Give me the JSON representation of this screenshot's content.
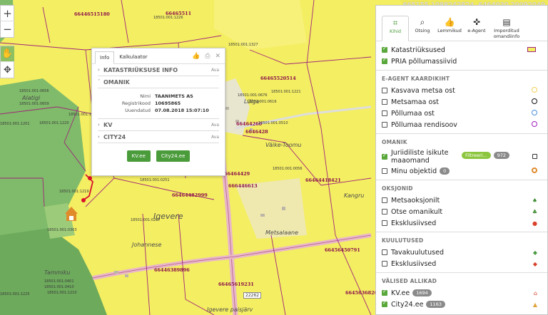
{
  "coords": "665155.1088242824, 6464030.20092049",
  "colors": {
    "accent": "#4a9b3a",
    "map_yellow": "#f4ee62",
    "forest_green": "#7fbb6a",
    "parcel_border": "#a0267a",
    "road": "#e8b8c8"
  },
  "map": {
    "big_labels": [
      "66446515180",
      "66465511",
      "66465520514",
      "66464260",
      "6646428",
      "666446613",
      "66464418421",
      "66464482999",
      "66464429",
      "66446389896",
      "66465619231",
      "66456450791",
      "66456368201"
    ],
    "parcel_ids": [
      "18501:001:1226",
      "18501:001:0656",
      "18501:001:0659",
      "18501:001:1201",
      "18501:001:1220",
      "18501:001:1243",
      "18501:001:1327",
      "18501:001:0676",
      "18501:001:0616",
      "18501:001:0510",
      "18501:001:0056",
      "18501:001:0257",
      "18501:001:0303",
      "18501:001:0251",
      "18501:001:0410",
      "18501:001:1225",
      "18501:001:1210",
      "18501:001:1221",
      "18501:001:0401",
      "18501:001:1219"
    ],
    "place_names": {
      "alatigi": "Alatigi",
      "luige": "Lüige",
      "vaike_toomu": "Väike-Toomu",
      "igevere": "Igevere",
      "johannese": "Johannese",
      "tammiku": "Tammiku",
      "kangru": "Kangru",
      "metsalaane": "Metsalaane",
      "igevere_paisjarv": "Igevere paisjärv"
    },
    "road_number": "22262"
  },
  "map_controls": {
    "zoom_in": "+",
    "zoom_out": "−"
  },
  "popup": {
    "tabs": [
      "Info",
      "Kalkulaator"
    ],
    "sections": {
      "katastri": "KATASTRIÜKSUSE INFO",
      "omanik": "OMANIK",
      "kv": "KV",
      "city24": "CITY24"
    },
    "open_label": "Ava",
    "owner": {
      "name_label": "Nimi",
      "name_value": "TAANIMETS AS",
      "reg_label": "Registrikood",
      "reg_value": "10695865",
      "updated_label": "Uuendatud",
      "updated_value": "07.08.2018 15:07:10"
    },
    "buttons": {
      "kv": "KV.ee",
      "city24": "City24.ee"
    }
  },
  "panel": {
    "tabs": [
      {
        "label": "Kihid",
        "icon": "layers-icon"
      },
      {
        "label": "Otsing",
        "icon": "search-icon"
      },
      {
        "label": "Lemmikud",
        "icon": "thumbs-up-icon"
      },
      {
        "label": "e-Agent",
        "icon": "crosshair-icon"
      },
      {
        "label": "Imporditud omandiinfo",
        "icon": "document-icon"
      }
    ],
    "base_layers": [
      {
        "label": "Katastriüksused",
        "checked": true
      },
      {
        "label": "PRIA põllumassiivid",
        "checked": true
      }
    ],
    "eagent": {
      "title": "E-AGENT KAARDIKIHT",
      "items": [
        {
          "label": "Kasvava metsa ost",
          "color": "#f1d35a"
        },
        {
          "label": "Metsamaa ost",
          "color": "#111111"
        },
        {
          "label": "Põllumaa ost",
          "color": "#4a90d9"
        },
        {
          "label": "Põllumaa rendisoov",
          "color": "#a020c0"
        }
      ]
    },
    "omanik": {
      "title": "OMANIK",
      "juriidilised": "Juriidiliste isikute maaomand",
      "filter_badge": "Filtreeri...",
      "count": "972",
      "minu": "Minu objektid",
      "minu_count": "0"
    },
    "oksjonid": {
      "title": "OKSJONID",
      "items": [
        {
          "label": "Metsaoksjonilt",
          "color": "#3c8a2e"
        },
        {
          "label": "Otse omanikult",
          "color": "#3c8a2e"
        },
        {
          "label": "Eksklusiivsed",
          "color": "#d9422a"
        }
      ]
    },
    "kuulutused": {
      "title": "KUULUTUSED",
      "items": [
        {
          "label": "Tavakuulutused",
          "color": "#4f9b45"
        },
        {
          "label": "Eksklusiivsed",
          "color": "#d9422a"
        }
      ]
    },
    "valised": {
      "title": "VÄLISED ALLIKAD",
      "items": [
        {
          "label": "KV.ee",
          "count": "1694",
          "color": "#d9422a"
        },
        {
          "label": "City24.ee",
          "count": "1163",
          "color": "#e0a33a"
        }
      ]
    }
  }
}
